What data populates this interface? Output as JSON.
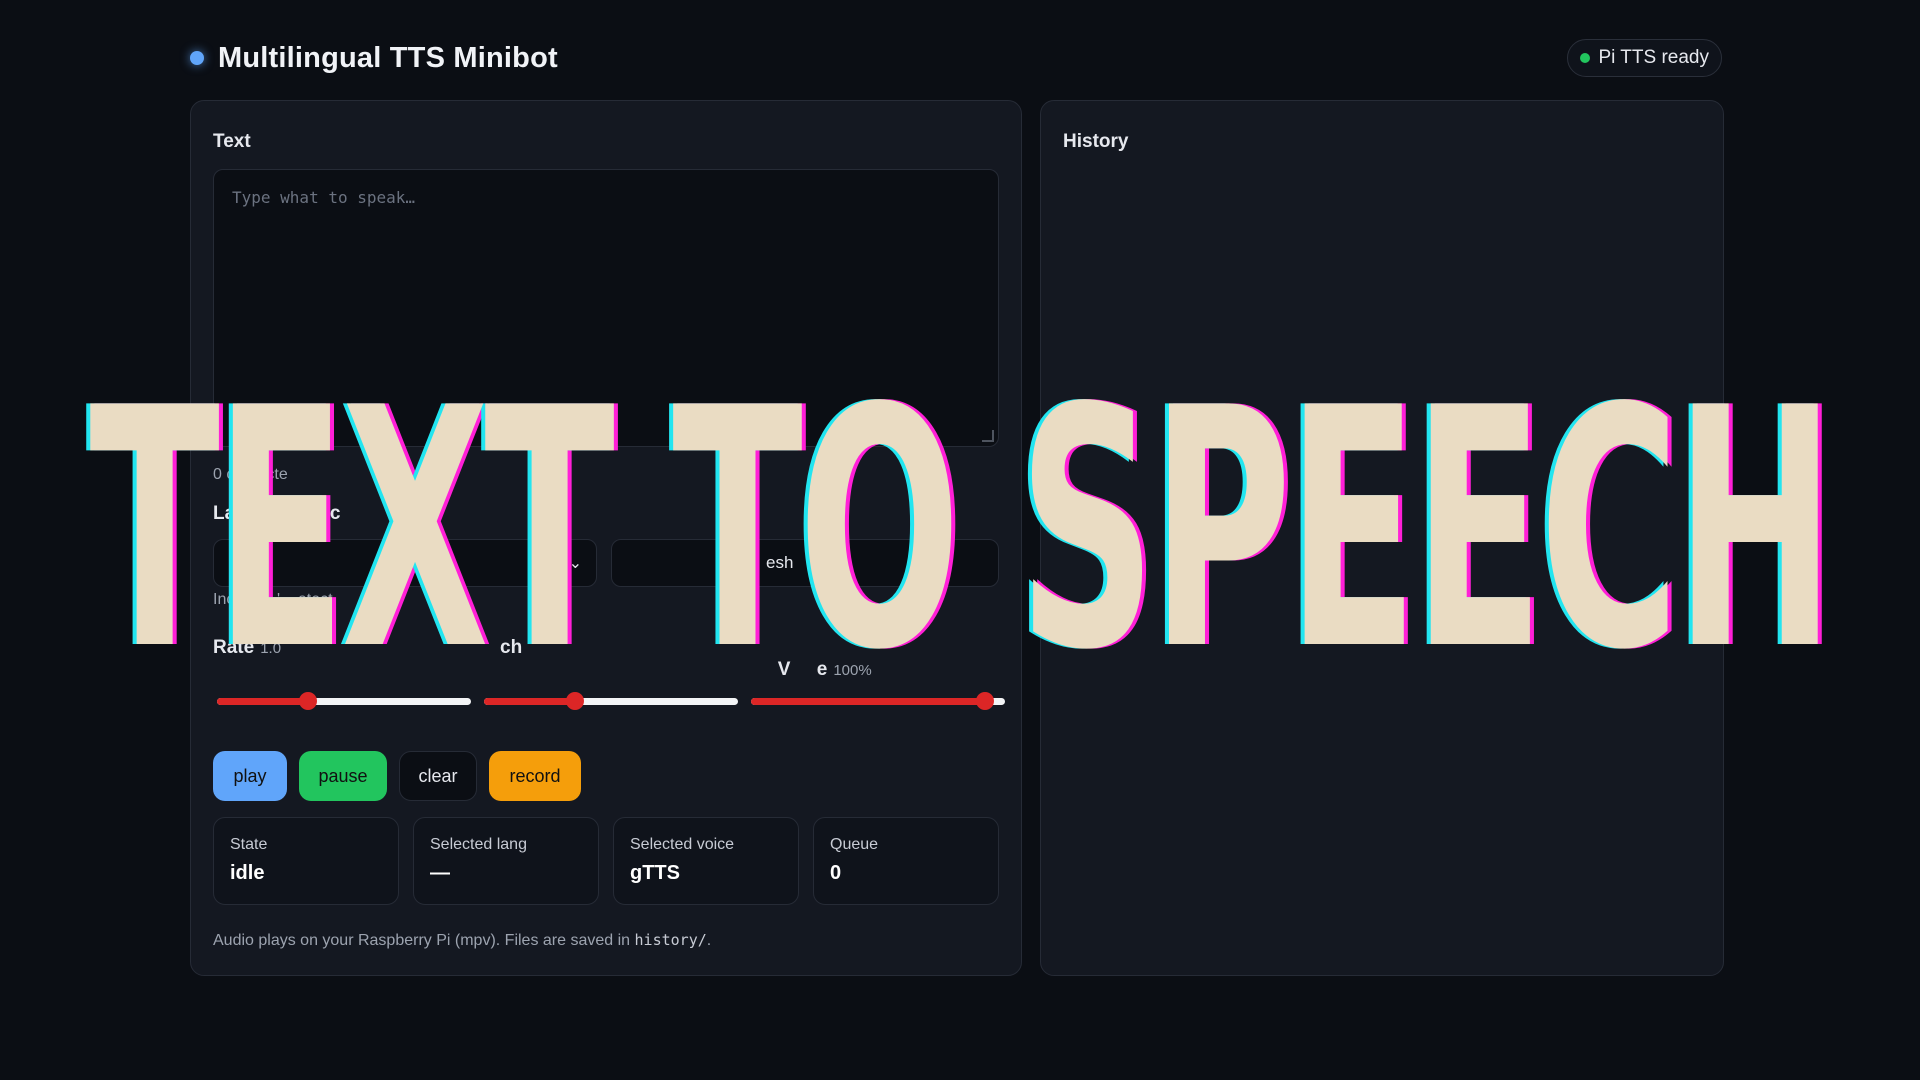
{
  "app": {
    "title": "Multilingual TTS Minibot",
    "status": "Pi TTS ready"
  },
  "main": {
    "text_label": "Text",
    "text_placeholder": "Type what to speak…",
    "char_count": "0 characte",
    "language_voice_label": "Langua    Voic",
    "language_select_value": "",
    "refresh_button_partial": "esh",
    "language_hint": "Includes '    etect",
    "sliders": {
      "rate": {
        "label": "Rate",
        "value_text": "1.0",
        "value": 0.36
      },
      "pitch": {
        "label": "ch",
        "value_text": "",
        "value": 0.36
      },
      "volume": {
        "label": "V     e",
        "value_text": "100%",
        "value": 0.92
      }
    },
    "buttons": {
      "play": "play",
      "pause": "pause",
      "clear": "clear",
      "record": "record"
    },
    "stats": [
      {
        "label": "State",
        "value": "idle"
      },
      {
        "label": "Selected lang",
        "value": "—"
      },
      {
        "label": "Selected voice",
        "value": "gTTS"
      },
      {
        "label": "Queue",
        "value": "0"
      }
    ],
    "footnote_prefix": "Audio plays on your Raspberry Pi (mpv). Files are saved in ",
    "footnote_code": "history/",
    "footnote_suffix": "."
  },
  "history": {
    "label": "History"
  },
  "overlay": {
    "banner_text": "TEXT TO SPEECH"
  },
  "colors": {
    "accent_blue": "#60a5fa",
    "ready_green": "#22c55e",
    "slider_red": "#dc2626",
    "record_orange": "#f59e0b",
    "banner_cream": "#eadcc3",
    "banner_cyan": "#22e5f0",
    "banner_magenta": "#ff1fd7"
  }
}
